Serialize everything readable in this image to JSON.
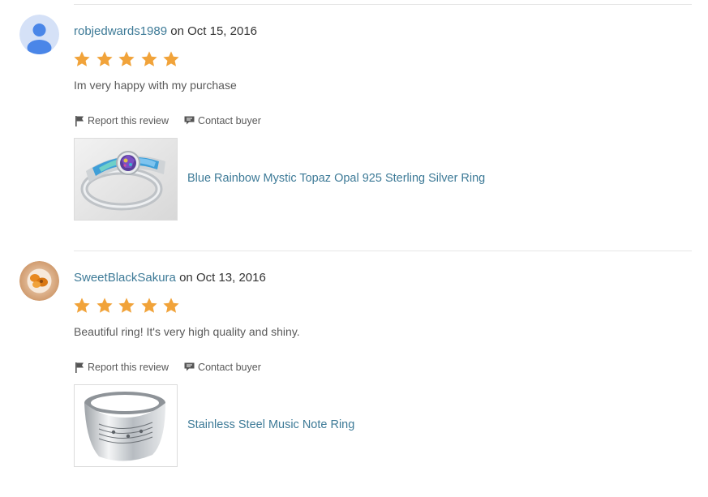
{
  "reviews": [
    {
      "username": "robjedwards1989",
      "date_prefix": " on ",
      "date": "Oct 15, 2016",
      "rating": 5,
      "text": "Im very happy with my purchase",
      "report_label": "Report this review",
      "contact_label": "Contact buyer",
      "product_title": "Blue Rainbow Mystic Topaz Opal 925 Sterling Silver Ring",
      "avatar_icon": "default-user-icon"
    },
    {
      "username": "SweetBlackSakura",
      "date_prefix": " on ",
      "date": "Oct 13, 2016",
      "rating": 5,
      "text": "Beautiful ring! It's very high quality and shiny.",
      "report_label": "Report this review",
      "contact_label": "Contact buyer",
      "product_title": "Stainless Steel Music Note Ring",
      "avatar_icon": "user-photo-avatar"
    }
  ],
  "colors": {
    "link": "#3d7a97",
    "star": "#f1a33a",
    "text": "#595959",
    "divider": "#e6e6e6"
  },
  "icons": [
    "flag-icon",
    "chat-icon",
    "star-icon"
  ]
}
